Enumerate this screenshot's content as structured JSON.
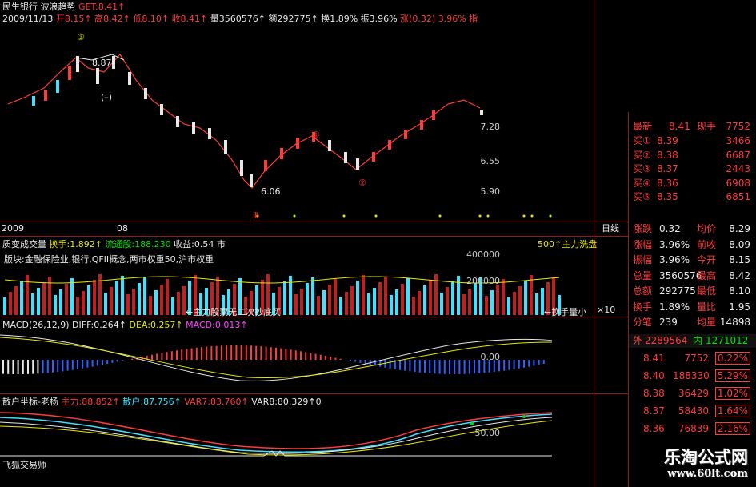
{
  "header": {
    "stock_name": "民生银行",
    "indicator_name": "波浪趋势",
    "indicator_value": "GET:8.41↑",
    "date": "2009/11/13",
    "open": "开8.15↑",
    "high": "高8.42↑",
    "low": "低8.10↑",
    "close": "收8.41↑",
    "volume": "量3560576↑",
    "amount": "额292775↑",
    "turnover": "换1.89%",
    "amplitude": "振3.96%",
    "change": "涨(0.32) 3.96% 指"
  },
  "main_chart": {
    "annot_top": "③",
    "annot_high_price": "8.87",
    "annot_low_price": "6.06",
    "annot_minus": "(–)",
    "annot_circle_2": "②",
    "annot_circle_1": "①",
    "annot_roman": "Ⅲ",
    "y_ticks": [
      "7.28",
      "6.55",
      "5.90"
    ],
    "x_labels": [
      "2009",
      "08"
    ],
    "period": "日线"
  },
  "volume_panel": {
    "title": "质变成交量",
    "turnover": "换手:1.892↑",
    "flow_shares": "流通股:188.230",
    "earnings": "收益:0.54",
    "market": "市",
    "main_force": "500↑主力洗盘",
    "sector": "版块:金融保险业,银行,QFII概念,两市权重50,沪市权重",
    "y_ticks": [
      "400000",
      "200000"
    ],
    "unit": "×10",
    "bottom_note": "←主力股票无二次抄底买",
    "min_turnover": "←换手量小"
  },
  "macd_panel": {
    "title": "MACD(26,12,9)",
    "diff": "DIFF:0.264↑",
    "dea": "DEA:0.257↑",
    "macd": "MACD:0.013↑",
    "y_tick": "0.00"
  },
  "bottom_panel": {
    "title": "散户坐标-老杨",
    "main_force": "主力:88.852↑",
    "retail": "散户:87.756↑",
    "var7": "VAR7:83.760↑",
    "var8": "VAR8:80.329↑0",
    "y_tick": "50.00",
    "footer": "飞狐交易师"
  },
  "quote_panel": {
    "latest_label": "最新",
    "latest_value": "8.41",
    "current_vol_label": "现手",
    "current_vol_value": "7752",
    "buy": [
      {
        "label": "买①",
        "price": "8.39",
        "vol": "3466"
      },
      {
        "label": "买②",
        "price": "8.38",
        "vol": "6687"
      },
      {
        "label": "买③",
        "price": "8.37",
        "vol": "2443"
      },
      {
        "label": "买④",
        "price": "8.36",
        "vol": "6908"
      },
      {
        "label": "买⑤",
        "price": "8.35",
        "vol": "6851"
      }
    ],
    "stats": [
      {
        "l1": "涨跌",
        "v1": "0.32",
        "l2": "均价",
        "v2": "8.29"
      },
      {
        "l1": "涨幅",
        "v1": "3.96%",
        "l2": "前收",
        "v2": "8.09"
      },
      {
        "l1": "振幅",
        "v1": "3.96%",
        "l2": "今开",
        "v2": "8.15"
      },
      {
        "l1": "总量",
        "v1": "3560576",
        "l2": "最高",
        "v2": "8.42"
      },
      {
        "l1": "总额",
        "v1": "292775",
        "l2": "最低",
        "v2": "8.10"
      },
      {
        "l1": "换手",
        "v1": "1.89%",
        "l2": "量比",
        "v2": "1.95"
      },
      {
        "l1": "分笔",
        "v1": "239",
        "l2": "均量",
        "v2": "14898"
      }
    ],
    "outer_label": "外",
    "outer_value": "2289564",
    "inner_label": "内",
    "inner_value": "1271012",
    "ticks": [
      {
        "price": "8.41",
        "vol": "7752",
        "pct": "0.22%"
      },
      {
        "price": "8.40",
        "vol": "188330",
        "pct": "5.29%"
      },
      {
        "price": "8.38",
        "vol": "36429",
        "pct": "1.02%"
      },
      {
        "price": "8.37",
        "vol": "58430",
        "pct": "1.64%"
      },
      {
        "price": "8.36",
        "vol": "76839",
        "pct": "2.16%"
      }
    ]
  },
  "watermark": {
    "brand": "乐淘公式网",
    "url": "www.60lt.com"
  },
  "colors": {
    "up": "#ff3b3b",
    "down": "#40e0ff",
    "grid": "#8a1c1c",
    "highlight": "#ffff00"
  }
}
